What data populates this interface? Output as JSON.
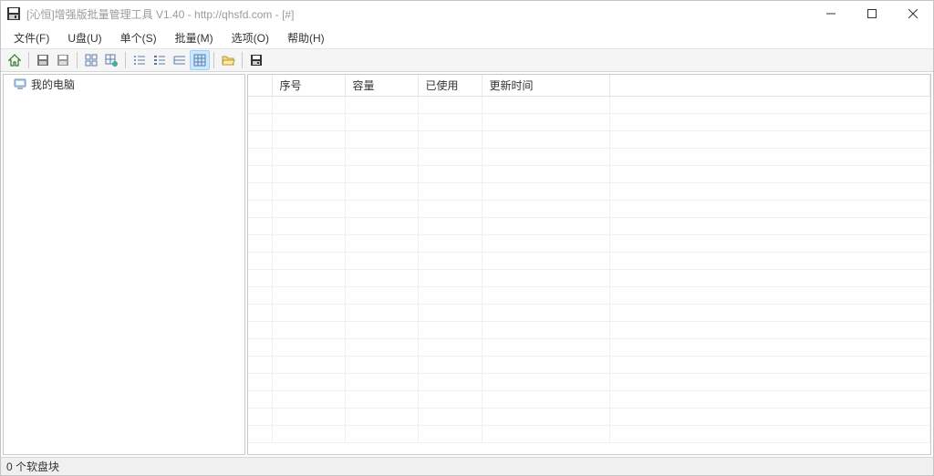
{
  "window": {
    "title": "[沁恒]增强版批量管理工具 V1.40 - http://qhsfd.com - [#]"
  },
  "menu": {
    "file": "文件(F)",
    "udisk": "U盘(U)",
    "single": "单个(S)",
    "batch": "批量(M)",
    "options": "选项(O)",
    "help": "帮助(H)"
  },
  "tree": {
    "root": "我的电脑"
  },
  "grid": {
    "columns": {
      "c0": "",
      "c1": "序号",
      "c2": "容量",
      "c3": "已使用",
      "c4": "更新时间",
      "c5": ""
    }
  },
  "status": {
    "text": "0 个软盘块"
  },
  "icons": {
    "app": "floppy-icon",
    "home": "home-icon",
    "disk1": "disk-icon",
    "disk2": "disk-icon",
    "grid1": "grid-cells-icon",
    "grid2": "grid-add-icon",
    "list1": "list-icon",
    "list2": "list-icon",
    "list3": "list-icon",
    "gridview": "grid-icon",
    "openfolder": "folder-open-icon",
    "save": "save-icon",
    "computer": "computer-icon"
  }
}
